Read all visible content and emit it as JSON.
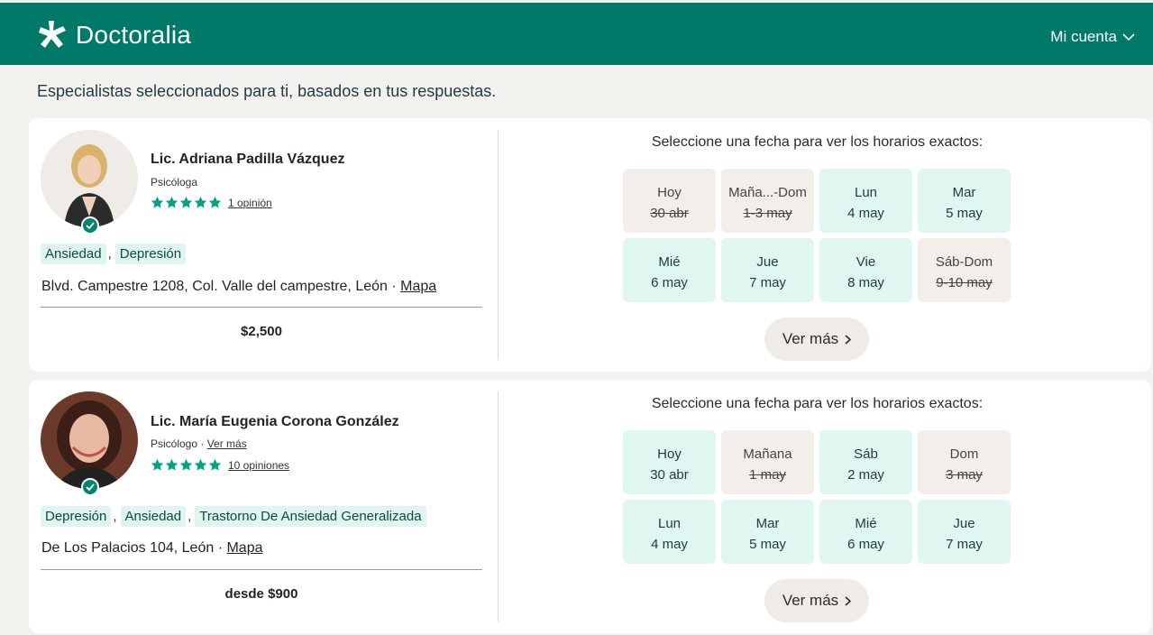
{
  "header": {
    "logo_text": "Doctoralia",
    "account_label": "Mi cuenta"
  },
  "page": {
    "heading": "Especialistas seleccionados para ti, basados en tus respuestas."
  },
  "doctors": [
    {
      "name": "Lic. Adriana Padilla Vázquez",
      "role": "Psicóloga",
      "role_link": "",
      "rating_stars": 5,
      "opinions": "1 opinión",
      "tags": [
        "Ansiedad",
        "Depresión"
      ],
      "address": "Blvd. Campestre 1208, Col. Valle del campestre, León · ",
      "map_link": "Mapa",
      "price": "$2,500",
      "calendar_title": "Seleccione una fecha para ver los horarios exactos:",
      "dates": [
        {
          "day": "Hoy",
          "date": "30 abr",
          "available": false
        },
        {
          "day": "Maña...-Dom",
          "date": "1-3 may",
          "available": false
        },
        {
          "day": "Lun",
          "date": "4 may",
          "available": true
        },
        {
          "day": "Mar",
          "date": "5 may",
          "available": true
        },
        {
          "day": "Mié",
          "date": "6 may",
          "available": true
        },
        {
          "day": "Jue",
          "date": "7 may",
          "available": true
        },
        {
          "day": "Vie",
          "date": "8 may",
          "available": true
        },
        {
          "day": "Sáb-Dom",
          "date": "9-10 may",
          "available": false
        }
      ],
      "more_label": "Ver más"
    },
    {
      "name": "Lic. María Eugenia Corona González",
      "role": "Psicólogo · ",
      "role_link": "Ver más",
      "rating_stars": 5,
      "opinions": "10 opiniones",
      "tags": [
        "Depresión",
        "Ansiedad",
        "Trastorno De Ansiedad Generalizada"
      ],
      "address": "De Los Palacios 104, León · ",
      "map_link": "Mapa",
      "price": "desde $900",
      "calendar_title": "Seleccione una fecha para ver los horarios exactos:",
      "dates": [
        {
          "day": "Hoy",
          "date": "30 abr",
          "available": true
        },
        {
          "day": "Mañana",
          "date": "1 may",
          "available": false
        },
        {
          "day": "Sáb",
          "date": "2 may",
          "available": true
        },
        {
          "day": "Dom",
          "date": "3 may",
          "available": false
        },
        {
          "day": "Lun",
          "date": "4 may",
          "available": true
        },
        {
          "day": "Mar",
          "date": "5 may",
          "available": true
        },
        {
          "day": "Mié",
          "date": "6 may",
          "available": true
        },
        {
          "day": "Jue",
          "date": "7 may",
          "available": true
        }
      ],
      "more_label": "Ver más"
    }
  ],
  "colors": {
    "brand": "#007a68",
    "available": "#dff6f1",
    "unavailable": "#f2efeb",
    "star": "#00a383"
  }
}
